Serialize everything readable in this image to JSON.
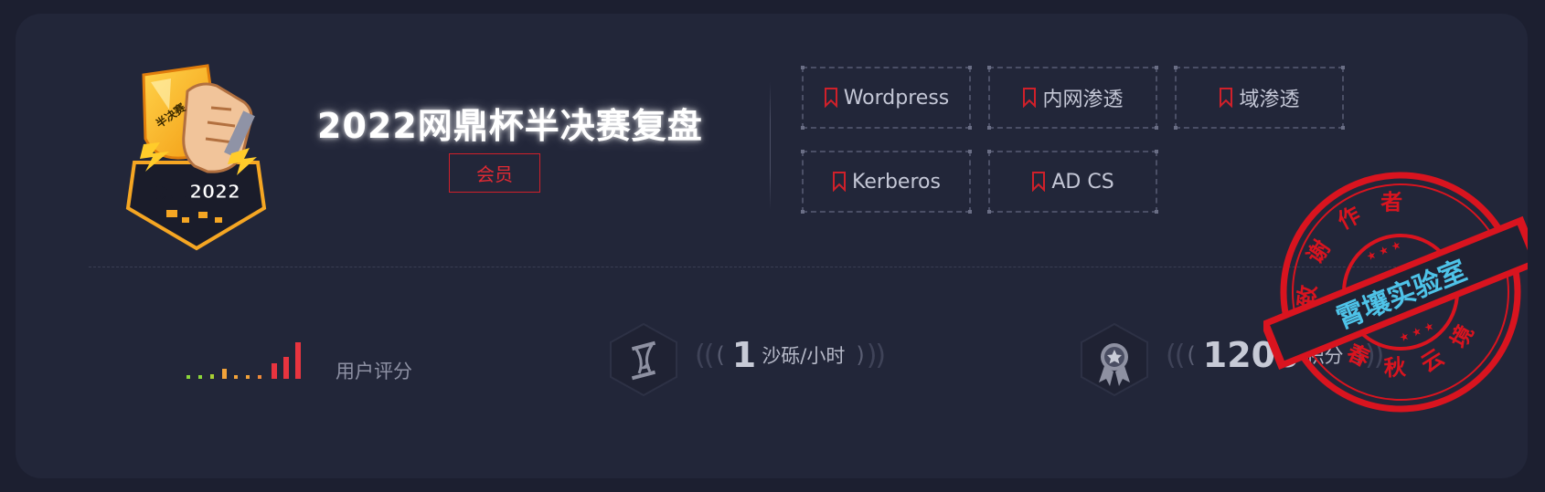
{
  "header": {
    "title": "2022网鼎杯半决赛复盘",
    "badge": "会员",
    "logo_text": "网鼎2022",
    "logo_sub": "半决赛"
  },
  "tags": [
    {
      "label": "Wordpress"
    },
    {
      "label": "内网渗透"
    },
    {
      "label": "域渗透"
    },
    {
      "label": "Kerberos"
    },
    {
      "label": "AD CS"
    }
  ],
  "stats": {
    "rating_label": "用户评分",
    "rating_level": 1.0,
    "sand": {
      "value": "1",
      "unit": "沙砾/小时",
      "icon": "hourglass-icon"
    },
    "points": {
      "value": "1200",
      "unit": "积分",
      "icon": "medal-icon"
    }
  },
  "stamp": {
    "top_text": "致谢作者",
    "bottom_text": "春秋云境",
    "band_text": "霄壤实验室"
  },
  "colors": {
    "accent_red": "#d0202a",
    "background": "#222639",
    "stamp_red": "#d9141f",
    "stamp_band_text": "#4ec3e8"
  }
}
